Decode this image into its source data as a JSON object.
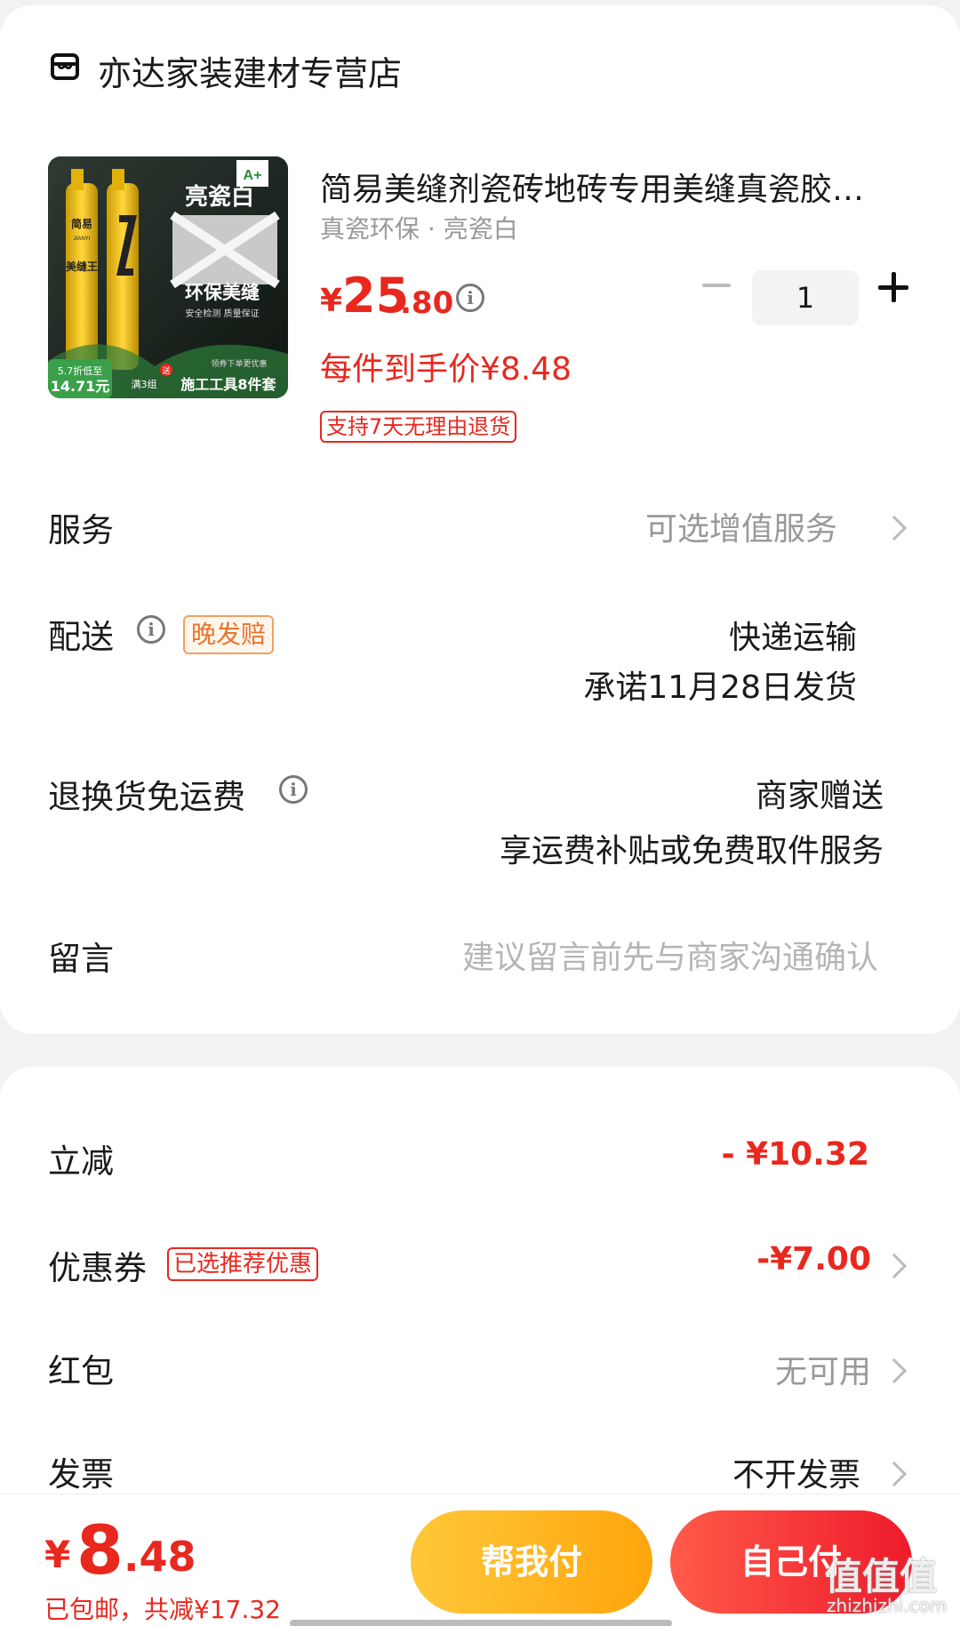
{
  "store": {
    "name": "亦达家装建材专营店"
  },
  "product": {
    "title": "简易美缝剂瓷砖地砖专用美缝真瓷胶…",
    "spec": "真瓷环保 · 亮瓷白",
    "price_symbol": "¥",
    "price_int": "25",
    "price_dec": ".80",
    "quantity": "1",
    "unit_price": "每件到手价¥8.48",
    "return_policy": "支持7天无理由退货",
    "image_text": {
      "badge": "A+",
      "color_name": "亮瓷白",
      "brand": "简易",
      "brand_en": "JIANYI",
      "product_name": "美缝王",
      "headline": "环保美缝",
      "subline": "安全检测 质量保证",
      "discount": "5.7折低至",
      "discount_price": "14.71元",
      "bundle": "满3组",
      "gift_tag": "送",
      "gift": "施工工具8件套",
      "promo": "领券下单更优惠"
    }
  },
  "service": {
    "label": "服务",
    "value": "可选增值服务"
  },
  "delivery": {
    "label": "配送",
    "badge": "晚发赔",
    "method": "快递运输",
    "promise": "承诺11月28日发货"
  },
  "return_shipping": {
    "label": "退换货免运费",
    "value": "商家赠送",
    "detail": "享运费补贴或免费取件服务"
  },
  "message": {
    "label": "留言",
    "placeholder": "建议留言前先与商家沟通确认"
  },
  "discounts": {
    "instant": {
      "label": "立减",
      "value": "- ¥10.32"
    },
    "coupon": {
      "label": "优惠券",
      "badge": "已选推荐优惠",
      "value": "-¥7.00"
    },
    "red_packet": {
      "label": "红包",
      "value": "无可用"
    },
    "invoice": {
      "label": "发票",
      "value": "不开发票"
    }
  },
  "footer": {
    "total_symbol": "¥",
    "total_int": "8",
    "total_dec": ".48",
    "summary": "已包邮，共减¥17.32",
    "help_pay": "帮我付",
    "self_pay": "自己付"
  },
  "watermark": {
    "text": "值值值",
    "url": "zhizhizhi.com"
  },
  "colors": {
    "accent": "#e8281f",
    "help_button": "#ffb320",
    "self_button": "#f2283a"
  }
}
